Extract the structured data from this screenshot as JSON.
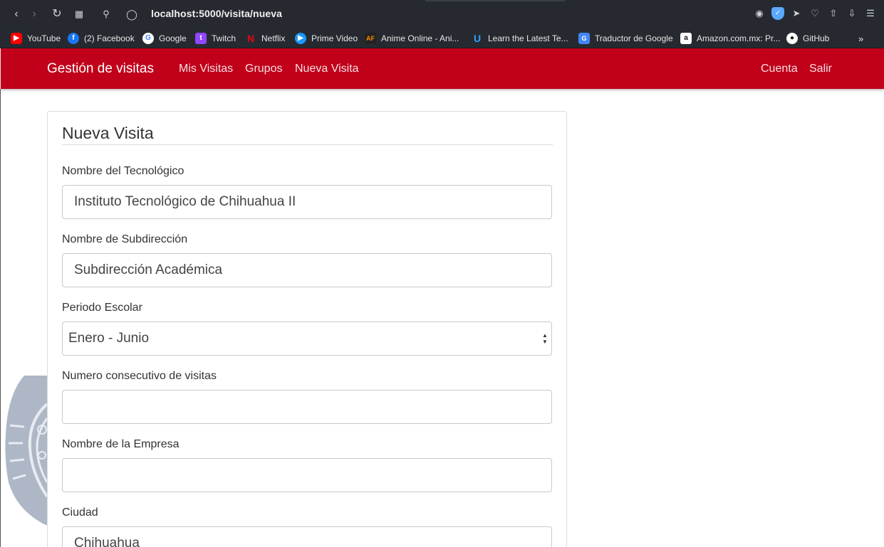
{
  "browser": {
    "url": "localhost:5000/visita/nueva",
    "bookmarks": [
      {
        "label": "YouTube",
        "icon": "youtube-icon",
        "color": "#ff0000"
      },
      {
        "label": "(2) Facebook",
        "icon": "facebook-icon",
        "color": "#1877f2"
      },
      {
        "label": "Google",
        "icon": "google-icon",
        "color": "#ffffff"
      },
      {
        "label": "Twitch",
        "icon": "twitch-icon",
        "color": "#9146ff"
      },
      {
        "label": "Netflix",
        "icon": "netflix-icon",
        "color": "#e50914"
      },
      {
        "label": "Prime Video",
        "icon": "prime-video-icon",
        "color": "#1a98ff"
      },
      {
        "label": "Anime Online - Ani...",
        "icon": "animeflv-icon",
        "color": "#ff8a00"
      },
      {
        "label": "Learn the Latest Te...",
        "icon": "udemy-icon",
        "color": "#2aa3ff"
      },
      {
        "label": "Traductor de Google",
        "icon": "google-translate-icon",
        "color": "#4285f4"
      },
      {
        "label": "Amazon.com.mx: Pr...",
        "icon": "amazon-icon",
        "color": "#ffffff"
      },
      {
        "label": "GitHub",
        "icon": "github-icon",
        "color": "#ffffff"
      }
    ]
  },
  "navbar": {
    "brand": "Gestión de visitas",
    "links": [
      "Mis Visitas",
      "Grupos",
      "Nueva Visita"
    ],
    "right_links": [
      "Cuenta",
      "Salir"
    ],
    "color": "#c1001a"
  },
  "form": {
    "title": "Nueva Visita",
    "fields": [
      {
        "label": "Nombre del Tecnológico",
        "value": "Instituto Tecnológico de Chihuahua II"
      },
      {
        "label": "Nombre de Subdirección",
        "value": "Subdirección Académica"
      },
      {
        "label": "Periodo Escolar",
        "value": "Enero - Junio"
      },
      {
        "label": "Numero consecutivo de visitas",
        "value": ""
      },
      {
        "label": "Nombre de la Empresa",
        "value": ""
      },
      {
        "label": "Ciudad",
        "value": "Chihuahua"
      }
    ]
  }
}
